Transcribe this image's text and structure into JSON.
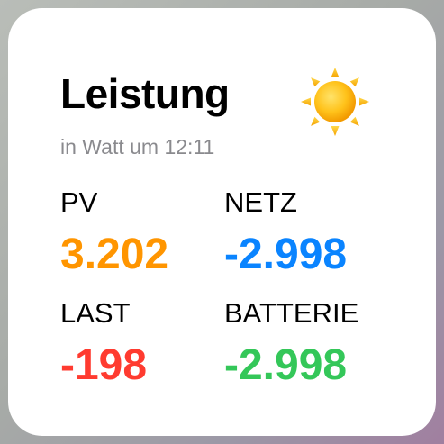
{
  "widget": {
    "title": "Leistung",
    "subtitle": "in Watt um 12:11",
    "weather_icon": "sun-icon",
    "pv": {
      "label": "PV",
      "value": "3.202",
      "color": "#ff9500"
    },
    "netz": {
      "label": "NETZ",
      "value": "-2.998",
      "color": "#0a84ff"
    },
    "last": {
      "label": "LAST",
      "value": "-198",
      "color": "#ff3b30"
    },
    "batterie": {
      "label": "BATTERIE",
      "value": "-2.998",
      "color": "#34c759"
    }
  }
}
